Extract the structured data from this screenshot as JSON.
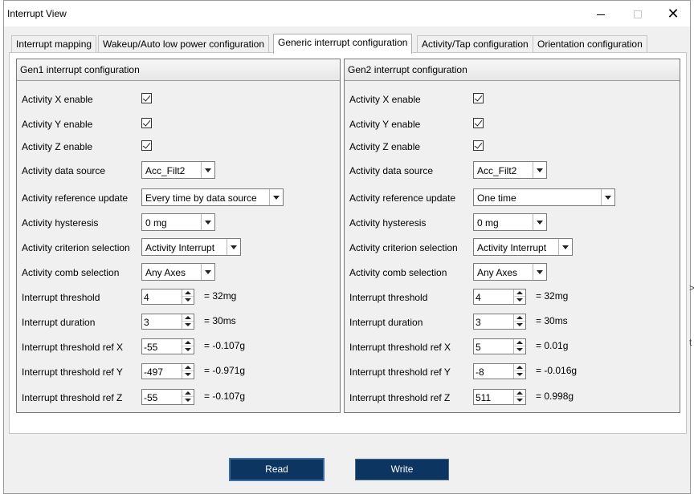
{
  "window": {
    "title": "Interrupt View"
  },
  "tabs": [
    {
      "label": "Interrupt mapping"
    },
    {
      "label": "Wakeup/Auto low power  configuration"
    },
    {
      "label": "Generic interrupt configuration"
    },
    {
      "label": "Activity/Tap configuration"
    },
    {
      "label": "Orientation configuration"
    }
  ],
  "labels": {
    "activity_x": "Activity X enable",
    "activity_y": "Activity Y enable",
    "activity_z": "Activity Z enable",
    "data_source": "Activity data source",
    "ref_update": "Activity reference update",
    "hysteresis": "Activity hysteresis",
    "criterion": "Activity criterion selection",
    "comb": "Activity comb selection",
    "threshold": "Interrupt threshold",
    "duration": "Interrupt duration",
    "ref_x": "Interrupt threshold ref X",
    "ref_y": "Interrupt threshold ref Y",
    "ref_z": "Interrupt threshold ref Z"
  },
  "gen1": {
    "title": "Gen1 interrupt configuration",
    "data_source": "Acc_Filt2",
    "ref_update": "Every time by data source",
    "hysteresis": "0 mg",
    "criterion": "Activity Interrupt",
    "comb": "Any Axes",
    "threshold": {
      "value": "4",
      "converted": "= 32mg"
    },
    "duration": {
      "value": "3",
      "converted": "= 30ms"
    },
    "ref_x": {
      "value": "-55",
      "converted": "= -0.107g"
    },
    "ref_y": {
      "value": "-497",
      "converted": "= -0.971g"
    },
    "ref_z": {
      "value": "-55",
      "converted": "= -0.107g"
    }
  },
  "gen2": {
    "title": "Gen2 interrupt configuration",
    "data_source": "Acc_Filt2",
    "ref_update": "One time",
    "hysteresis": "0 mg",
    "criterion": "Activity Interrupt",
    "comb": "Any Axes",
    "threshold": {
      "value": "4",
      "converted": "= 32mg"
    },
    "duration": {
      "value": "3",
      "converted": "= 30ms"
    },
    "ref_x": {
      "value": "5",
      "converted": "= 0.01g"
    },
    "ref_y": {
      "value": "-8",
      "converted": "= -0.016g"
    },
    "ref_z": {
      "value": "511",
      "converted": "= 0.998g"
    }
  },
  "buttons": {
    "read": "Read",
    "write": "Write"
  },
  "offscreen": {
    "glyph_a": ">",
    "glyph_b": "t"
  }
}
